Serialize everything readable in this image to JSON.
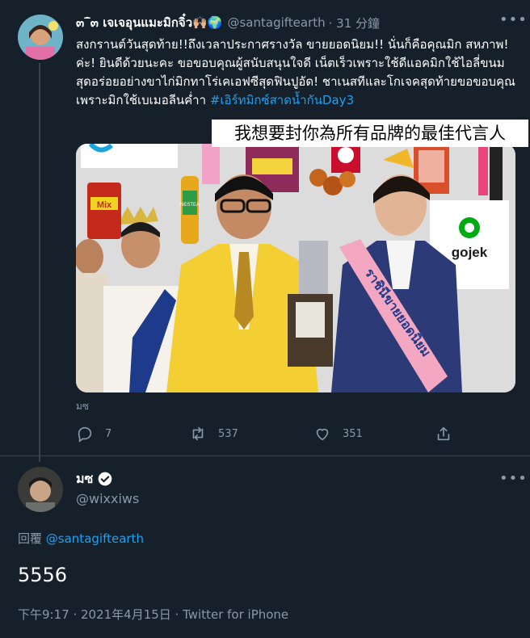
{
  "tweet": {
    "display_name": "๓‾̑๓ เจเจอุนแมะมิกจิ๋ว🙌🏼🌍",
    "handle": "@santagiftearth",
    "time": "· 31 分鐘",
    "text_part": "สงกรานต์วันสุดท้าย!!ถึงเวลาประกาศรางวัล ขายยอดนิยม!! นั่นก็คือคุณมิก สหภาพ! ค่ะ! ยินดีด้วยนะคะ ขอขอบคุณผู้สนับสนุนใจดี เน็ตเร็วเพราะใช้ดีแอคมิกใช้ไอลี่ขนมสุดอร่อยอย่างขาไก่มิกทาโร่เคเอฟซีสุดฟินปูอัด! ชาเนสทีและโกเจคสุดท้ายขอขอบคุณเพราะมิกใช้เบเมอลีนค่ำา",
    "hashtag": "#เอิร์ทมิกซ์สาดน้ำกันDay3",
    "caption_overlay": "我想要封你為所有品牌的最佳代言人",
    "image_label": "มซ",
    "sash_text": "ราชินีขายยอดนิยม",
    "brand_labels": {
      "mix": "Mix",
      "nestea": "NESTEA",
      "gojek": "gojek"
    },
    "actions": {
      "reply": "7",
      "retweet": "537",
      "like": "351"
    }
  },
  "reply": {
    "display_name": "มซ",
    "handle": "@wixxiws",
    "reply_label": "回覆",
    "reply_to": "@santagiftearth",
    "text": "5556",
    "meta": "下午9:17 · 2021年4月15日 · Twitter for iPhone"
  },
  "colors": {
    "background": "#15202b",
    "accent": "#1da1f2",
    "secondary_text": "#8899a6",
    "divider": "#38444d"
  },
  "icons": [
    "reply-icon",
    "retweet-icon",
    "like-icon",
    "share-icon",
    "verified-icon",
    "more-icon"
  ]
}
